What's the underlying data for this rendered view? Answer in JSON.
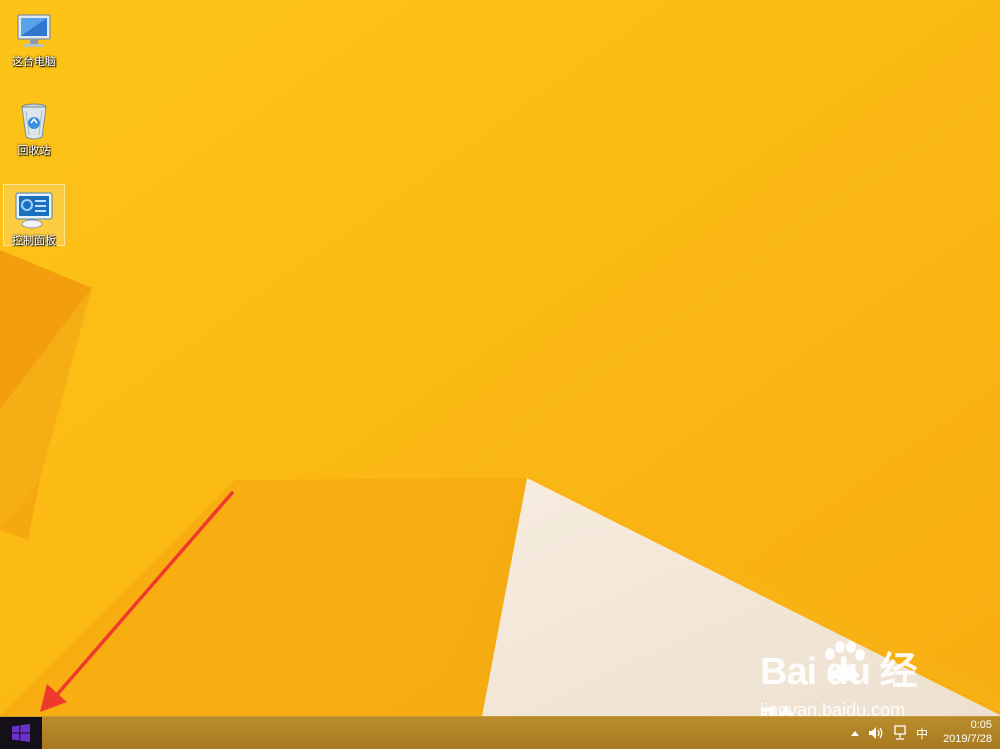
{
  "desktop": {
    "icons": [
      {
        "label": "这台电脑",
        "icon": "computer-icon"
      },
      {
        "label": "回收站",
        "icon": "recycle-bin-icon"
      },
      {
        "label": "控制面板",
        "icon": "control-panel-icon",
        "selected": true
      }
    ]
  },
  "taskbar": {
    "start_icon": "windows-logo-icon",
    "tray": {
      "show_hidden_icon": "chevron-up-icon",
      "volume_icon": "speaker-icon",
      "network_icon": "network-icon",
      "ime_label": "中"
    },
    "clock": {
      "time": "0:05",
      "date": "2019/7/28"
    }
  },
  "watermark": {
    "logo_text": "Bai  du 经验",
    "url": "jingyan.baidu.com"
  },
  "colors": {
    "wallpaper_base": "#fbb914",
    "wallpaper_dark": "#f3a00c",
    "wallpaper_light": "#f2e6d7",
    "annotation_arrow": "#ee3a2c",
    "start_button": "#14101a",
    "windows_logo": "#6a32c8"
  }
}
